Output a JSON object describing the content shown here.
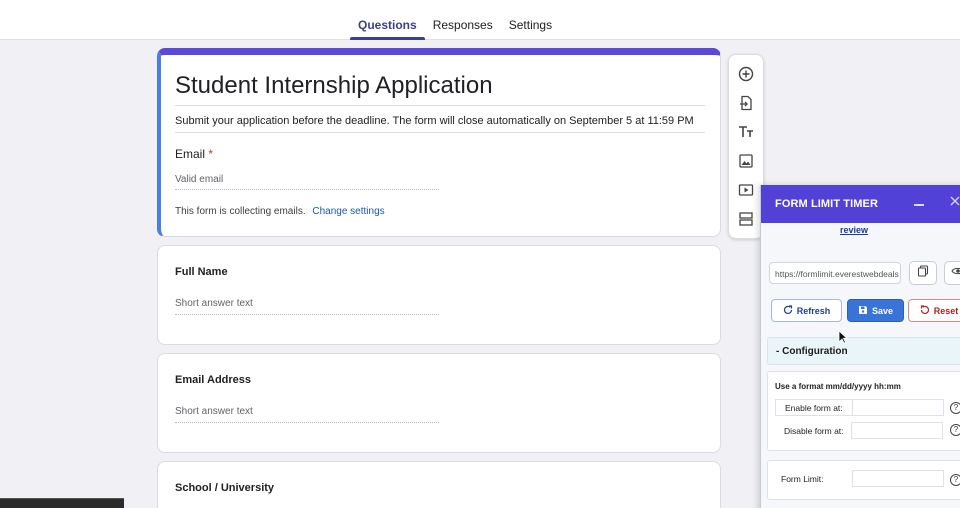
{
  "tabs": [
    {
      "label": "Questions",
      "active": true
    },
    {
      "label": "Responses",
      "active": false
    },
    {
      "label": "Settings",
      "active": false
    }
  ],
  "form": {
    "title": "Student Internship Application",
    "description": "Submit your application before the deadline. The form will close automatically on September 5 at 11:59 PM",
    "email_label": "Email",
    "required_mark": "*",
    "email_placeholder": "Valid email",
    "collecting_text": "This form is collecting emails.",
    "change_settings": "Change settings"
  },
  "questions": [
    {
      "title": "Full Name",
      "answer": "Short answer text"
    },
    {
      "title": "Email Address",
      "answer": "Short answer text"
    },
    {
      "title": "School / University",
      "answer": ""
    }
  ],
  "toolbar_icons": [
    "add-question-icon",
    "import-questions-icon",
    "add-title-icon",
    "add-image-icon",
    "add-video-icon",
    "add-section-icon"
  ],
  "panel": {
    "title": "FORM LIMIT TIMER",
    "review_link": "review",
    "url": "https://formlimit.everestwebdeals",
    "refresh_label": "Refresh",
    "save_label": "Save",
    "reset_label": "Reset",
    "config_label": "- Configuration",
    "format_hint": "Use a format mm/dd/yyyy hh:mm",
    "enable_label": "Enable form at:",
    "disable_label": "Disable form at:",
    "limit_label": "Form Limit:",
    "help_glyph": "?"
  },
  "colors": {
    "accent": "#5141d6",
    "header_border": "#5b4ad8",
    "save_button": "#3a73d8",
    "reset_text": "#b22222"
  }
}
